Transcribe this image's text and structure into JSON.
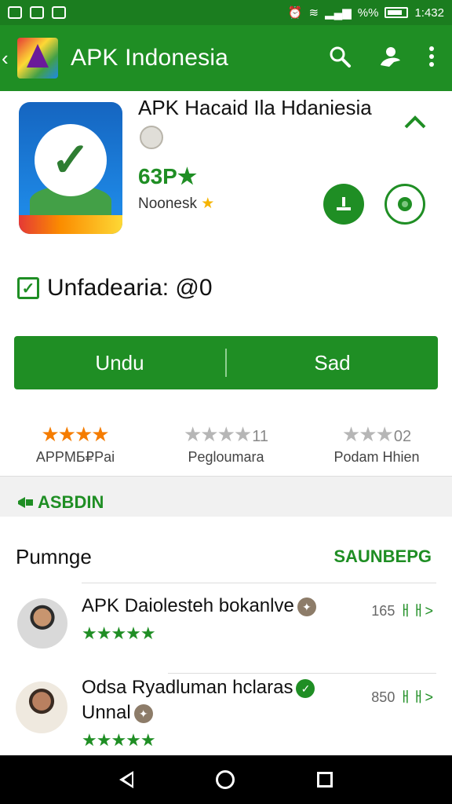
{
  "status_bar": {
    "time": "1:432",
    "battery": "%%"
  },
  "app_bar": {
    "title": "APK Indonesia",
    "actions": [
      "search-icon",
      "account-icon",
      "more-vert-icon"
    ]
  },
  "header": {
    "title": "APK Hacaid Ila Hdaniesia",
    "size": "63P★",
    "region": "Noonesk",
    "region_star": "★"
  },
  "verified": {
    "label": "Unfadearia: @0"
  },
  "split_button": {
    "left": "Undu",
    "right": "Sad"
  },
  "ratings": [
    {
      "stars": "★★★★",
      "num": "",
      "label": "APPMБ₽Pai",
      "color": "orange"
    },
    {
      "stars": "★★★★",
      "num": "11",
      "label": "Pegloumara",
      "color": "gray"
    },
    {
      "stars": "★★★",
      "num": "02",
      "label": "Podam Hhien",
      "color": "gray"
    }
  ],
  "section": {
    "tag": "ASBDIN"
  },
  "list": {
    "heading": "Pumnge",
    "more_label": "SAUNBЕPG",
    "reviews": [
      {
        "name": "APK Daiolesteh bokanlve",
        "sub": "",
        "stars": "★★★★★",
        "count": "165",
        "count_suffix": "ㅐㅐ>"
      },
      {
        "name": "Odsa Ryadluman hclaras",
        "sub": "Unnal",
        "stars": "★★★★★",
        "count": "850",
        "count_suffix": "ㅐㅐ>"
      }
    ]
  },
  "colors": {
    "primary": "#1f8e24",
    "star": "#f57c00"
  }
}
